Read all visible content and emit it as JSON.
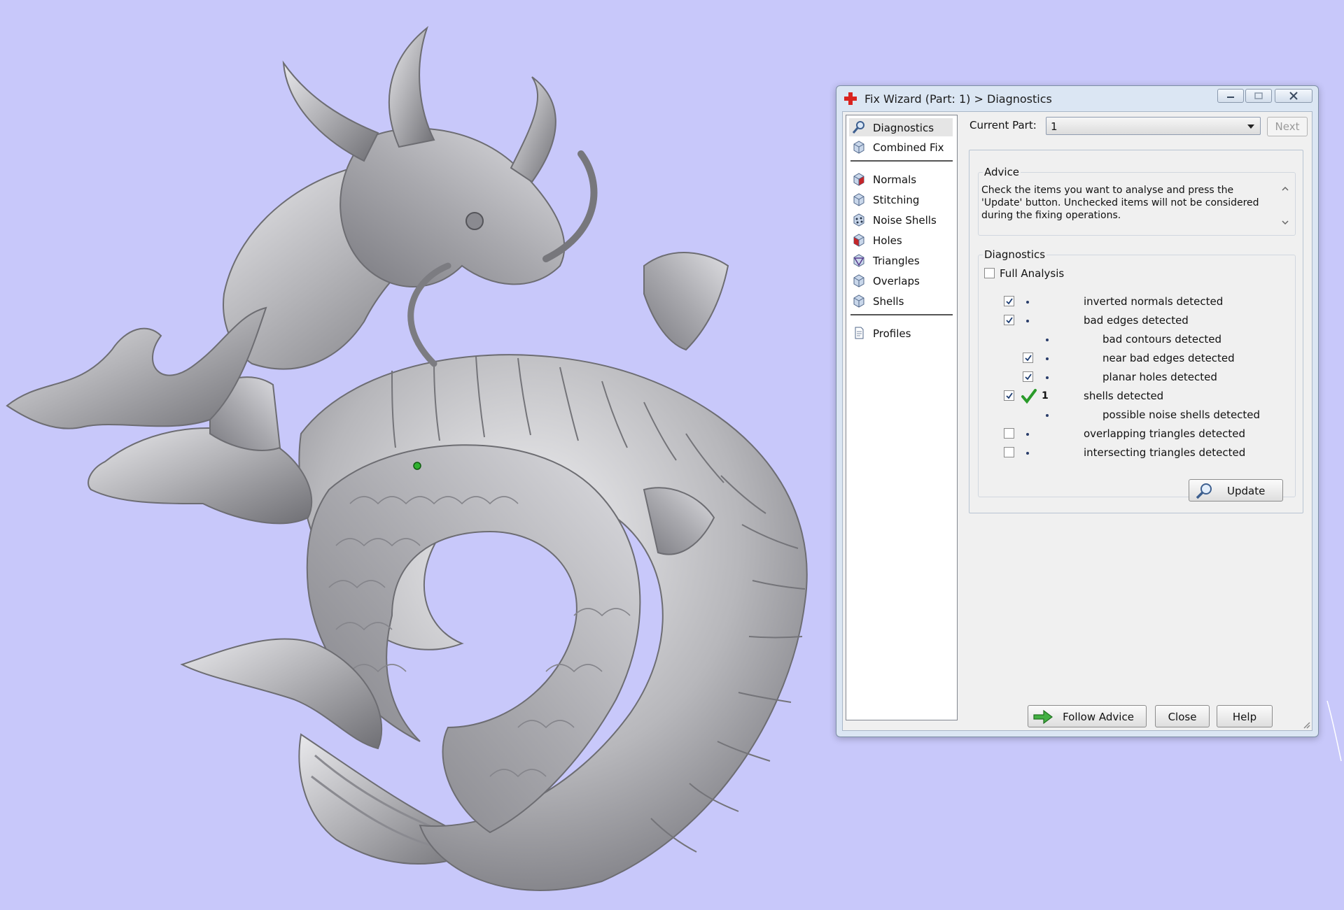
{
  "colors": {
    "background": "#c8c8fa",
    "model": "#a8a8ab",
    "check": "#2a9b2a"
  },
  "viewport": {
    "subject": "dragon-relief-model"
  },
  "dialog": {
    "title": "Fix Wizard (Part: 1) > Diagnostics",
    "nav": {
      "items": [
        {
          "label": "Diagnostics",
          "icon": "magnifier-icon",
          "selected": true
        },
        {
          "label": "Combined Fix",
          "icon": "cube-icon"
        },
        {
          "label": "Normals",
          "icon": "cube-red-icon"
        },
        {
          "label": "Stitching",
          "icon": "cube-icon"
        },
        {
          "label": "Noise Shells",
          "icon": "noise-cube-icon"
        },
        {
          "label": "Holes",
          "icon": "cube-red-icon"
        },
        {
          "label": "Triangles",
          "icon": "triangle-cube-icon"
        },
        {
          "label": "Overlaps",
          "icon": "cube-icon"
        },
        {
          "label": "Shells",
          "icon": "cube-icon"
        },
        {
          "label": "Profiles",
          "icon": "document-icon"
        }
      ]
    },
    "current_part_label": "Current Part:",
    "current_part_value": "1",
    "next_label": "Next",
    "advice": {
      "title": "Advice",
      "text": "Check the items you want to analyse and press the 'Update' button. Unchecked items will not be considered during the fixing operations."
    },
    "diagnostics": {
      "title": "Diagnostics",
      "full_analysis_label": "Full Analysis",
      "full_analysis_checked": false,
      "rows": [
        {
          "label": "inverted normals detected",
          "checked": true
        },
        {
          "label": "bad edges detected",
          "checked": true
        },
        {
          "label": "bad contours detected"
        },
        {
          "label": "near bad edges detected",
          "checked": true
        },
        {
          "label": "planar holes detected",
          "checked": true
        },
        {
          "label": "shells detected",
          "checked": true,
          "count": "1",
          "status": "ok"
        },
        {
          "label": "possible noise shells detected"
        },
        {
          "label": "overlapping triangles detected",
          "checked": false
        },
        {
          "label": "intersecting triangles detected",
          "checked": false
        }
      ]
    },
    "update_label": "Update",
    "follow_advice_label": "Follow Advice",
    "close_label": "Close",
    "help_label": "Help"
  }
}
